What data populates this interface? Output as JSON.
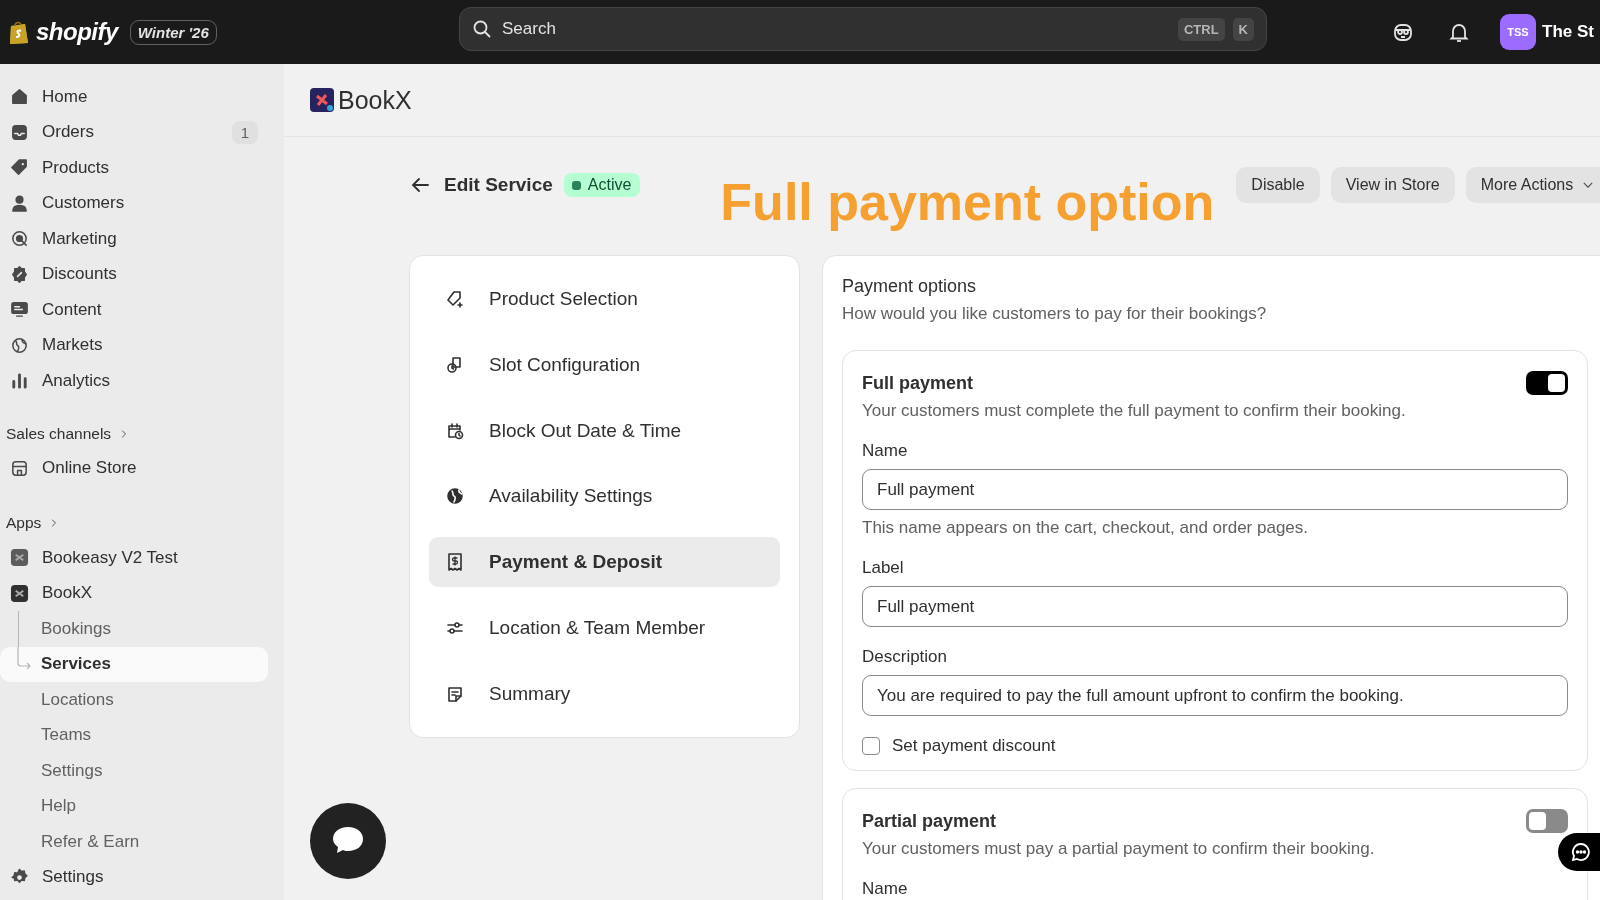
{
  "topbar": {
    "brand": "shopify",
    "edition": "Winter '26",
    "search": {
      "placeholder": "Search"
    },
    "shortcut": [
      "CTRL",
      "K"
    ],
    "avatar": "TSS",
    "store_name": "The St"
  },
  "sidebar": {
    "items": [
      {
        "label": "Home",
        "selected": false
      },
      {
        "label": "Orders",
        "badge": "1",
        "selected": false
      },
      {
        "label": "Products",
        "selected": false
      },
      {
        "label": "Customers",
        "selected": false
      },
      {
        "label": "Marketing",
        "selected": false
      },
      {
        "label": "Discounts",
        "selected": false
      },
      {
        "label": "Content",
        "selected": false
      },
      {
        "label": "Markets",
        "selected": false
      },
      {
        "label": "Analytics",
        "selected": false
      }
    ],
    "sales_channels": {
      "title": "Sales channels",
      "items": [
        {
          "label": "Online Store",
          "selected": false
        }
      ]
    },
    "apps": {
      "title": "Apps",
      "items": [
        {
          "label": "Bookeasy V2 Test",
          "selected": false
        },
        {
          "label": "BookX",
          "selected": false,
          "children": [
            {
              "label": "Bookings",
              "selected": false
            },
            {
              "label": "Services",
              "selected": true
            },
            {
              "label": "Locations",
              "selected": false
            },
            {
              "label": "Teams",
              "selected": false
            },
            {
              "label": "Settings",
              "selected": false
            },
            {
              "label": "Help",
              "selected": false
            },
            {
              "label": "Refer & Earn",
              "selected": false
            }
          ]
        }
      ]
    },
    "footer_item": {
      "label": "Settings",
      "selected": false
    }
  },
  "app_header": {
    "title": "BookX"
  },
  "page": {
    "title": "Edit Service",
    "status": "Active",
    "annotation": "Full payment option",
    "actions": [
      {
        "label": "Disable",
        "menu": false
      },
      {
        "label": "View in Store",
        "menu": false
      },
      {
        "label": "More Actions",
        "menu": true
      }
    ]
  },
  "steps": [
    {
      "label": "Product Selection",
      "selected": false
    },
    {
      "label": "Slot Configuration",
      "selected": false
    },
    {
      "label": "Block Out Date & Time",
      "selected": false
    },
    {
      "label": "Availability Settings",
      "selected": false
    },
    {
      "label": "Payment & Deposit",
      "selected": true
    },
    {
      "label": "Location & Team Member",
      "selected": false
    },
    {
      "label": "Summary",
      "selected": false
    }
  ],
  "payment_options": {
    "title": "Payment options",
    "subtitle": "How would you like customers to pay for their bookings?",
    "options": [
      {
        "title": "Full payment",
        "description": "Your customers must complete the full payment to confirm their booking.",
        "on": true,
        "fields": [
          {
            "label": "Name",
            "value": "Full payment",
            "help": "This name appears on the cart, checkout, and order pages."
          },
          {
            "label": "Label",
            "value": "Full payment"
          },
          {
            "label": "Description",
            "value": "You are required to pay the full amount upfront to confirm the booking."
          }
        ],
        "discount": {
          "label": "Set payment discount",
          "checked": false
        }
      },
      {
        "title": "Partial payment",
        "description": "Your customers must pay a partial payment to confirm their booking.",
        "on": false,
        "fields": [
          {
            "label": "Name"
          }
        ]
      }
    ]
  }
}
